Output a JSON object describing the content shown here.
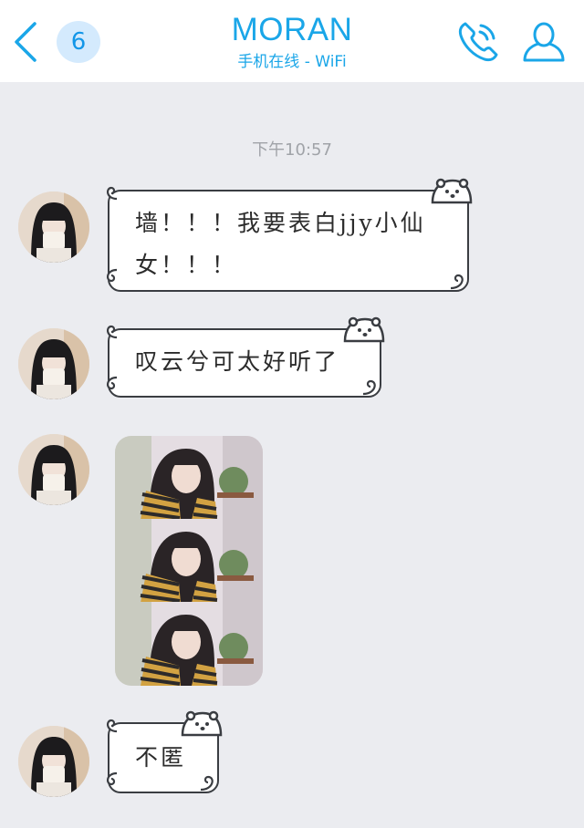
{
  "header": {
    "unread_count": "6",
    "title": "MORAN",
    "status": "手机在线 - WiFi"
  },
  "conversation": {
    "timestamp": "下午10:57",
    "messages": [
      {
        "type": "text",
        "text": "墙！！！我要表白jjy小仙女！！！"
      },
      {
        "type": "text",
        "text": "叹云兮可太好听了"
      },
      {
        "type": "image",
        "frames": 3
      },
      {
        "type": "text",
        "text": "不匿"
      }
    ]
  },
  "colors": {
    "accent": "#1aa6e8",
    "badge_bg": "#d4eafd",
    "chat_bg": "#ebecf0",
    "timestamp": "#a0a3a8"
  },
  "icons": [
    "back-arrow-icon",
    "phone-icon",
    "profile-icon",
    "bear-icon"
  ]
}
